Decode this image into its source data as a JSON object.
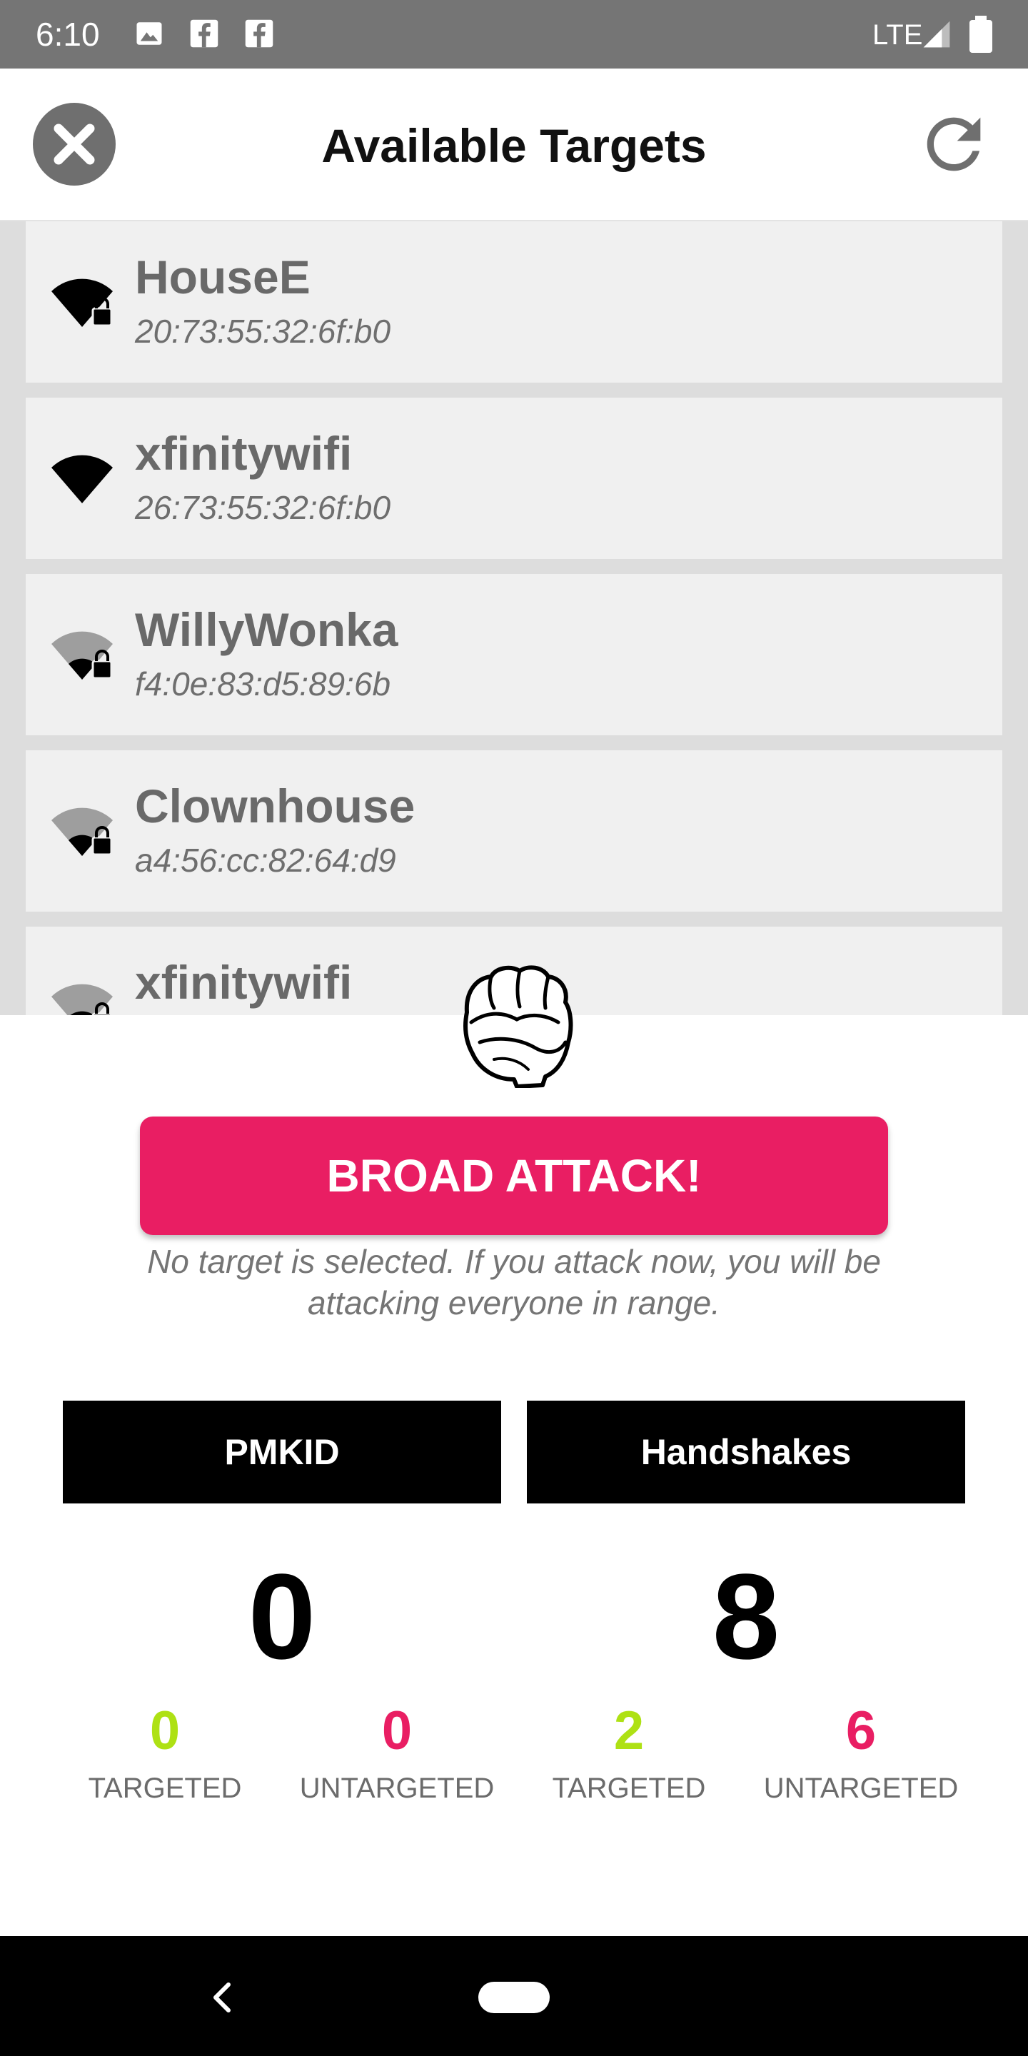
{
  "status_bar": {
    "time": "6:10",
    "network": "LTE"
  },
  "header": {
    "title": "Available Targets"
  },
  "targets": [
    {
      "ssid": "HouseE",
      "bssid": "20:73:55:32:6f:b0",
      "signal": "strong",
      "locked": true
    },
    {
      "ssid": "xfinitywifi",
      "bssid": "26:73:55:32:6f:b0",
      "signal": "strong",
      "locked": false
    },
    {
      "ssid": "WillyWonka",
      "bssid": "f4:0e:83:d5:89:6b",
      "signal": "weak",
      "locked": true
    },
    {
      "ssid": "Clownhouse",
      "bssid": "a4:56:cc:82:64:d9",
      "signal": "weak",
      "locked": true
    },
    {
      "ssid": "xfinitywifi",
      "bssid": "",
      "signal": "weak",
      "locked": true
    }
  ],
  "attack": {
    "button_label": "BROAD ATTACK!",
    "note": "No target is selected. If you attack now, you will be attacking everyone in range."
  },
  "stats": {
    "pmkid": {
      "label": "PMKID",
      "total": "0",
      "targeted": "0",
      "targeted_label": "TARGETED",
      "untargeted": "0",
      "untargeted_label": "UNTARGETED"
    },
    "handshakes": {
      "label": "Handshakes",
      "total": "8",
      "targeted": "2",
      "targeted_label": "TARGETED",
      "untargeted": "6",
      "untargeted_label": "UNTARGETED"
    }
  },
  "colors": {
    "accent": "#e91e63",
    "targeted": "#aee114",
    "untargeted": "#e91e63",
    "status_bar": "#757575"
  },
  "icons": {
    "close": "close-icon",
    "refresh": "refresh-icon",
    "wifi": "wifi-icon",
    "lock": "lock-icon",
    "fist": "fist-icon"
  }
}
